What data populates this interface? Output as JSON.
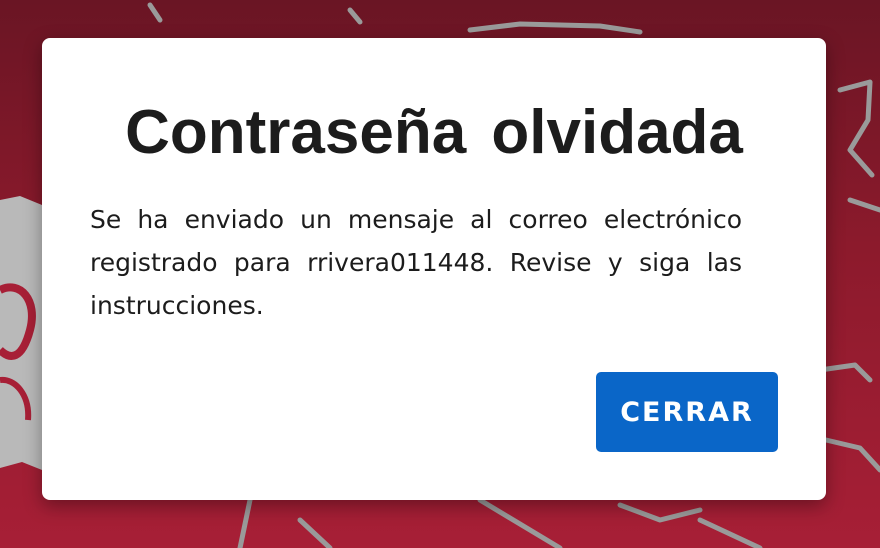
{
  "dialog": {
    "title": "Contraseña olvidada",
    "message": "Se ha enviado un mensaje al correo electrónico registrado para rrivera011448. Revise y siga las instrucciones.",
    "close_label": "CERRAR"
  },
  "colors": {
    "background": "#8c1a2c",
    "dialog": "#ffffff",
    "button": "#0a66c8",
    "button_text": "#ffffff",
    "text": "#1c1c1c"
  }
}
